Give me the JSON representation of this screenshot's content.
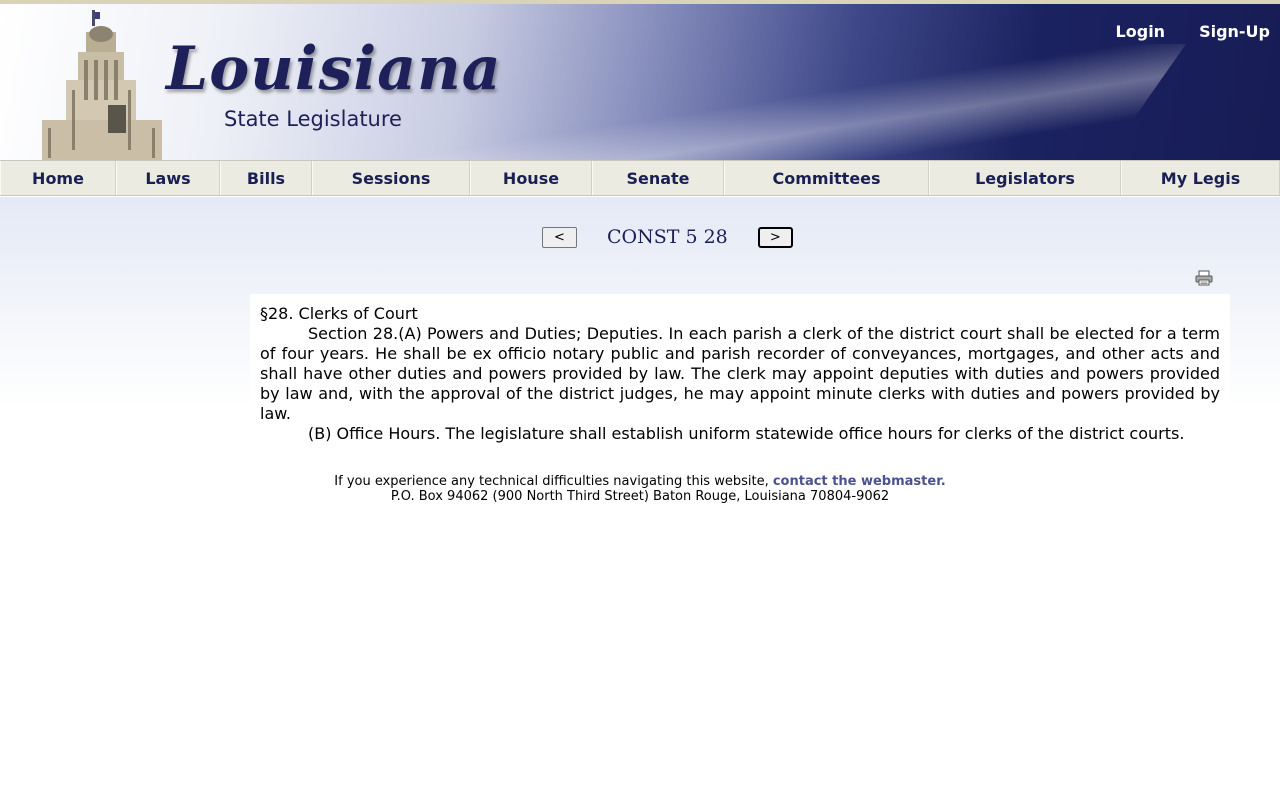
{
  "header": {
    "logo_word": "Louisiana",
    "logo_sub": "State Legislature",
    "login": "Login",
    "signup": "Sign-Up"
  },
  "nav": [
    {
      "label": "Home",
      "w": 0
    },
    {
      "label": "Laws"
    },
    {
      "label": "Bills"
    },
    {
      "label": "Sessions"
    },
    {
      "label": "House"
    },
    {
      "label": "Senate"
    },
    {
      "label": "Committees"
    },
    {
      "label": "Legislators"
    },
    {
      "label": "My Legis"
    }
  ],
  "doc": {
    "prev": "<",
    "next": ">",
    "title": "CONST 5 28",
    "heading": "§28.  Clerks of Court",
    "para1": "Section 28.(A)  Powers and Duties; Deputies.  In each parish a clerk of the district court shall be elected for a term of four years.  He shall be ex officio notary public and parish recorder of conveyances, mortgages, and other acts and shall have other duties and powers provided by law.  The clerk may appoint deputies with duties and powers provided by law and, with the approval of the district judges, he may appoint minute clerks with duties and powers provided by law.",
    "para2": "(B)  Office Hours.  The legislature shall establish uniform statewide office hours for clerks of the district courts."
  },
  "footer": {
    "line1": "If you experience any technical difficulties navigating this website, ",
    "link": "contact the webmaster.",
    "line2": "P.O. Box 94062 (900 North Third Street) Baton Rouge, Louisiana 70804-9062"
  },
  "icons": {
    "print": "printer-icon",
    "capitol": "capitol-building-image"
  },
  "colors": {
    "navy": "#1d2059",
    "nav_bg": "#ecebe2",
    "link": "#4a528f"
  }
}
